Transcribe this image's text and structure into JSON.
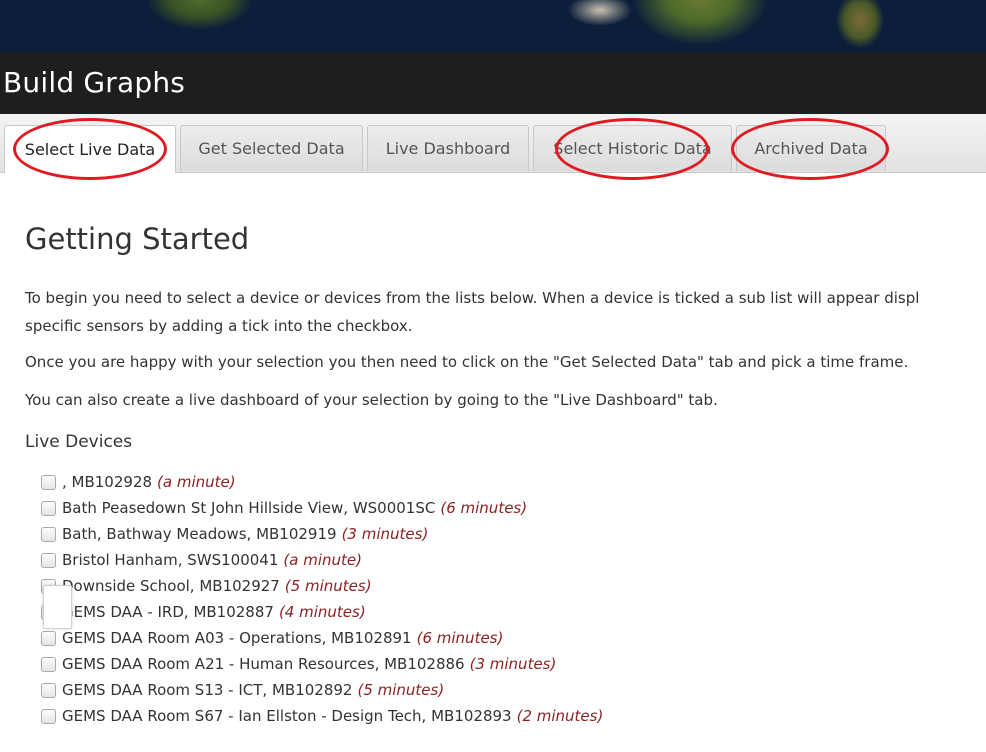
{
  "header": {
    "title": "Build Graphs"
  },
  "tabs": [
    {
      "label": "Select Live Data",
      "active": true
    },
    {
      "label": "Get Selected Data",
      "active": false
    },
    {
      "label": "Live Dashboard",
      "active": false
    },
    {
      "label": "Select Historic Data",
      "active": false
    },
    {
      "label": "Archived Data",
      "active": false
    }
  ],
  "main": {
    "heading": "Getting Started",
    "paragraphs": [
      "To begin you need to select a device or devices from the lists below. When a device is ticked a sub list will appear displ",
      "specific sensors by adding a tick into the checkbox.",
      "Once you are happy with your selection you then need to click on the \"Get Selected Data\" tab and pick a time frame.",
      "You can also create a live dashboard of your selection by going to the \"Live Dashboard\" tab."
    ],
    "section_title": "Live Devices",
    "devices": [
      {
        "name": ", MB102928",
        "time": "(a minute)"
      },
      {
        "name": "Bath Peasedown St John Hillside View, WS0001SC",
        "time": "(6 minutes)"
      },
      {
        "name": "Bath, Bathway Meadows, MB102919",
        "time": "(3 minutes)"
      },
      {
        "name": "Bristol Hanham, SWS100041",
        "time": "(a minute)"
      },
      {
        "name": "Downside School, MB102927",
        "time": "(5 minutes)"
      },
      {
        "name": "GEMS DAA - IRD, MB102887",
        "time": "(4 minutes)"
      },
      {
        "name": "GEMS DAA Room A03 - Operations, MB102891",
        "time": "(6 minutes)"
      },
      {
        "name": "GEMS DAA Room A21 - Human Resources, MB102886",
        "time": "(3 minutes)"
      },
      {
        "name": "GEMS DAA Room S13 - ICT, MB102892",
        "time": "(5 minutes)"
      },
      {
        "name": "GEMS DAA Room S67 - Ian Ellston - Design Tech, MB102893",
        "time": "(2 minutes)"
      }
    ]
  },
  "colors": {
    "annotation_ring": "#e01a22",
    "time_text": "#8b2323",
    "title_bar": "#1e1e1e"
  }
}
